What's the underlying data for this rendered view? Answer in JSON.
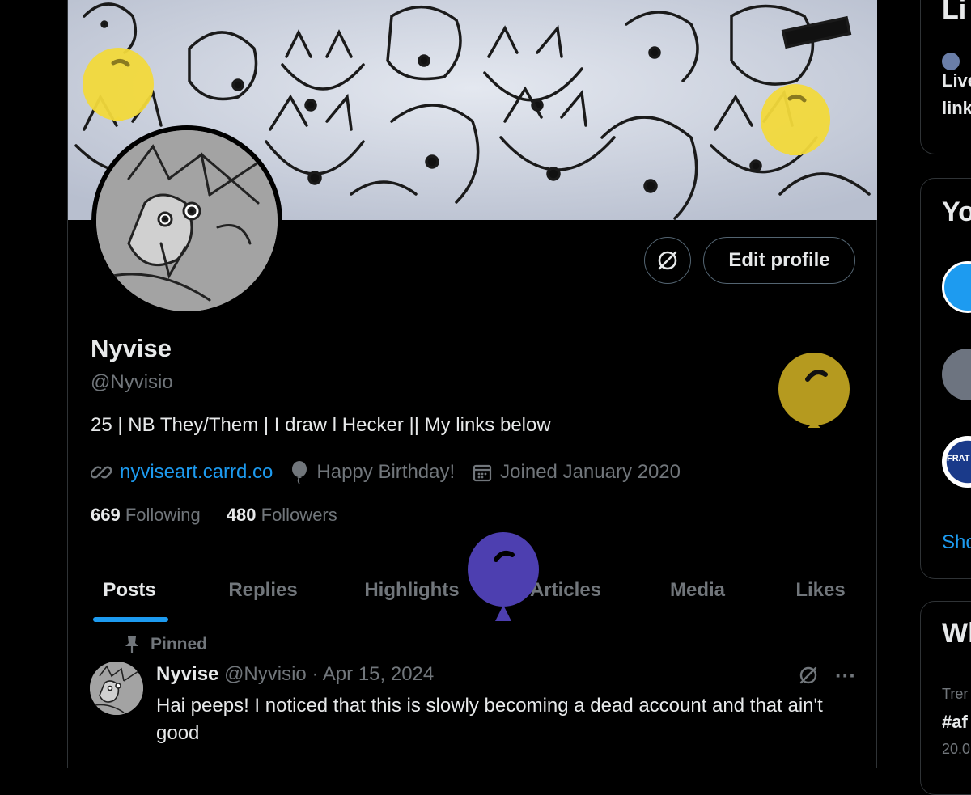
{
  "profile": {
    "name": "Nyvise",
    "handle": "@Nyvisio",
    "bio": "25 | NB They/Them | I draw l Hecker || My links below",
    "website": "nyviseart.carrd.co",
    "birthday": "Happy Birthday!",
    "joined": "Joined January 2020",
    "following_count": "669",
    "following_label": "Following",
    "followers_count": "480",
    "followers_label": "Followers"
  },
  "buttons": {
    "edit_profile": "Edit profile"
  },
  "tabs": [
    {
      "label": "Posts",
      "active": true
    },
    {
      "label": "Replies"
    },
    {
      "label": "Highlights"
    },
    {
      "label": "Articles"
    },
    {
      "label": "Media"
    },
    {
      "label": "Likes"
    }
  ],
  "pinned_tweet": {
    "pinned_label": "Pinned",
    "author_name": "Nyvise",
    "author_handle": "@Nyvisio",
    "separator": " · ",
    "date": "Apr 15, 2024",
    "text": "Hai peeps! I noticed that this is slowly becoming a dead account and that ain't good",
    "more": "···"
  },
  "sidebar": {
    "card1_title": "Li",
    "card1_line1": "Live",
    "card1_line2": "link",
    "card2_title": "Yo",
    "card2_avatar_text": "FRAT d'ITA",
    "card2_show": "Sho",
    "card3_title": "Wl",
    "card3_trend_label": "Trer",
    "card3_trend_tag": "#af",
    "card3_trend_count": "20.0"
  },
  "colors": {
    "accent": "#1d9bf0",
    "balloon_yellow": "#f2d93b",
    "balloon_gold": "#b59a1f",
    "balloon_purple": "#4d3fb0",
    "border": "#2f3336",
    "muted": "#71767b"
  },
  "icons": [
    "link-icon",
    "balloon-icon",
    "calendar-icon",
    "grok-icon",
    "pin-icon",
    "more-icon"
  ]
}
